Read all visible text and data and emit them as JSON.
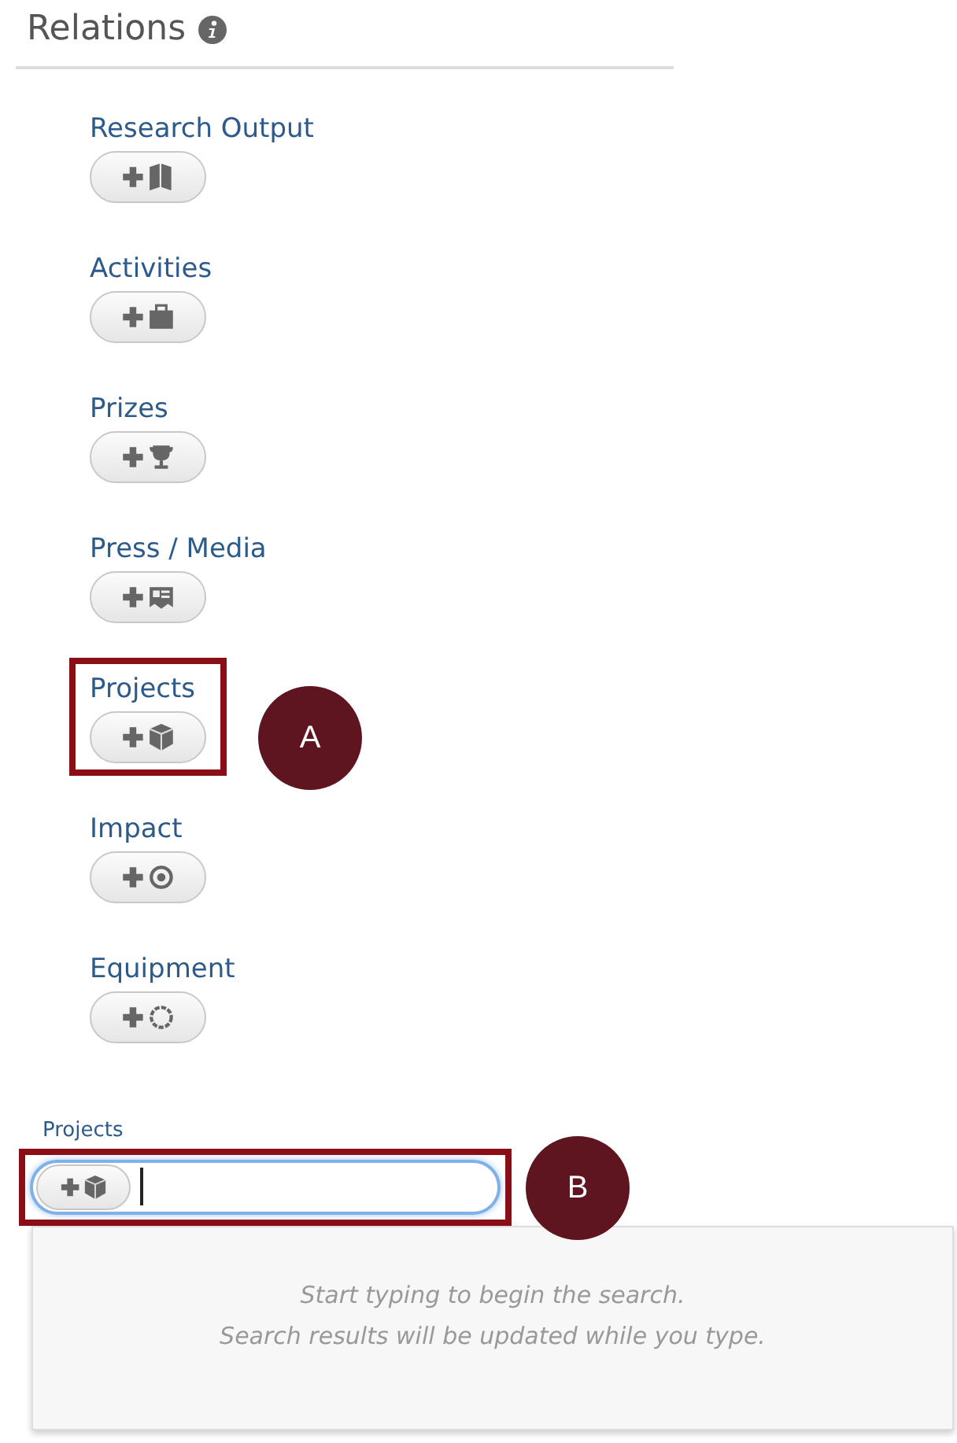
{
  "section": {
    "title": "Relations"
  },
  "items": [
    {
      "label": "Research Output",
      "kind": "book",
      "highlighted": false
    },
    {
      "label": "Activities",
      "kind": "briefcase",
      "highlighted": false
    },
    {
      "label": "Prizes",
      "kind": "trophy",
      "highlighted": false
    },
    {
      "label": "Press / Media",
      "kind": "news",
      "highlighted": false
    },
    {
      "label": "Projects",
      "kind": "cube",
      "highlighted": true,
      "callout": "A"
    },
    {
      "label": "Impact",
      "kind": "target",
      "highlighted": false
    },
    {
      "label": "Equipment",
      "kind": "ring",
      "highlighted": false
    }
  ],
  "search": {
    "label": "Projects",
    "kind": "cube",
    "focused": true,
    "highlighted": true,
    "callout": "B",
    "messages": [
      "Start typing to begin the search.",
      "Search results will be updated while you type."
    ]
  }
}
